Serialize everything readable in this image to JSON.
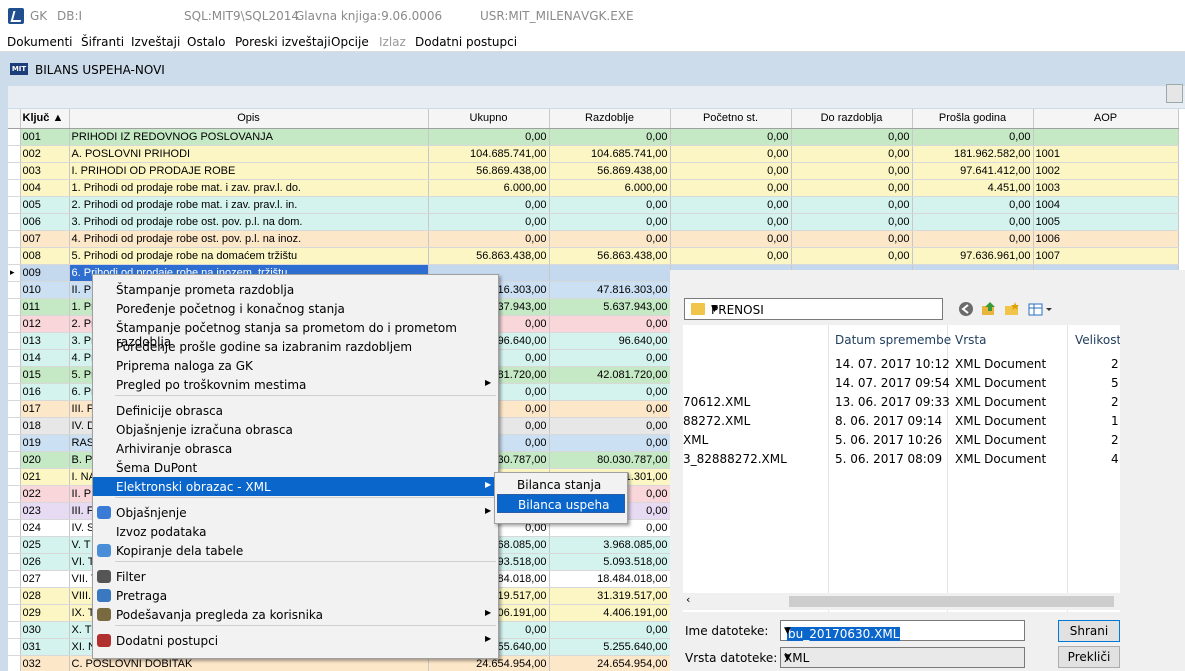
{
  "titlebar": {
    "app": "GK",
    "db": "DB:I",
    "sql": "SQL:MIT9\\SQL2014",
    "ledger": "Glavna knjiga:9.06.0006",
    "user": "USR:MIT_MILENA",
    "exe": "VGK.EXE"
  },
  "menu": [
    "Dokumenti",
    "Šifranti",
    "Izveštaji",
    "Ostalo",
    "Poreski izveštaji",
    "Opcije",
    "Izlaz",
    "Dodatni postupci"
  ],
  "window_title": "BILANS USPEHA-NOVI",
  "grid": {
    "headers": [
      "Ključ",
      "Opis",
      "Ukupno",
      "Razdoblje",
      "Početno st.",
      "Do razdoblja",
      "Prošla godina",
      "AOP"
    ],
    "rows": [
      {
        "k": "001",
        "o": "PRIHODI IZ REDOVNOG POSLOVANJA",
        "u": "0,00",
        "r": "0,00",
        "p": "0,00",
        "d": "0,00",
        "pg": "0,00",
        "a": "",
        "c": "green"
      },
      {
        "k": "002",
        "o": "A. POSLOVNI PRIHODI",
        "u": "104.685.741,00",
        "r": "104.685.741,00",
        "p": "0,00",
        "d": "0,00",
        "pg": "181.962.582,00",
        "a": "1001",
        "c": "yellow"
      },
      {
        "k": "003",
        "o": "I. PRIHODI OD PRODAJE ROBE",
        "u": "56.869.438,00",
        "r": "56.869.438,00",
        "p": "0,00",
        "d": "0,00",
        "pg": "97.641.412,00",
        "a": "1002",
        "c": "yellow"
      },
      {
        "k": "004",
        "o": "1. Prihodi od prodaje robe mat. i zav. prav.l. do.",
        "u": "6.000,00",
        "r": "6.000,00",
        "p": "0,00",
        "d": "0,00",
        "pg": "4.451,00",
        "a": "1003",
        "c": "yellow"
      },
      {
        "k": "005",
        "o": "2. Prihodi od prodaje robe mat. i zav. prav.l. in.",
        "u": "0,00",
        "r": "0,00",
        "p": "0,00",
        "d": "0,00",
        "pg": "0,00",
        "a": "1004",
        "c": "cyan"
      },
      {
        "k": "006",
        "o": "3. Prihodi od prodaje robe ost. pov. p.l. na dom.",
        "u": "0,00",
        "r": "0,00",
        "p": "0,00",
        "d": "0,00",
        "pg": "0,00",
        "a": "1005",
        "c": "cyan"
      },
      {
        "k": "007",
        "o": "4. Prihodi od prodaje robe ost. pov. p.l. na inoz.",
        "u": "0,00",
        "r": "0,00",
        "p": "0,00",
        "d": "0,00",
        "pg": "0,00",
        "a": "1006",
        "c": "peach"
      },
      {
        "k": "008",
        "o": "5. Prihodi od prodaje robe na domaćem tržištu",
        "u": "56.863.438,00",
        "r": "56.863.438,00",
        "p": "0,00",
        "d": "0,00",
        "pg": "97.636.961,00",
        "a": "1007",
        "c": "yellow"
      },
      {
        "k": "009",
        "o": "6. Prihodi od prodaje robe na inozem. tržištu",
        "u": "",
        "r": "",
        "p": "",
        "d": "",
        "pg": "",
        "a": "",
        "c": "sel"
      },
      {
        "k": "010",
        "o": "II. PI",
        "u": "47.816.303,00",
        "r": "47.816.303,00",
        "p": "",
        "d": "",
        "pg": "",
        "a": "",
        "c": "blue"
      },
      {
        "k": "011",
        "o": "1. Pr",
        "u": "5.637.943,00",
        "r": "5.637.943,00",
        "p": "",
        "d": "",
        "pg": "",
        "a": "",
        "c": "green"
      },
      {
        "k": "012",
        "o": "2. Pr",
        "u": "0,00",
        "r": "0,00",
        "p": "",
        "d": "",
        "pg": "",
        "a": "",
        "c": "pink"
      },
      {
        "k": "013",
        "o": "3. Pr",
        "u": "96.640,00",
        "r": "96.640,00",
        "p": "",
        "d": "",
        "pg": "",
        "a": "",
        "c": "cyan"
      },
      {
        "k": "014",
        "o": "4. Pr",
        "u": "0,00",
        "r": "0,00",
        "p": "",
        "d": "",
        "pg": "",
        "a": "",
        "c": "cyan"
      },
      {
        "k": "015",
        "o": "5. Pr",
        "u": "42.081.720,00",
        "r": "42.081.720,00",
        "p": "",
        "d": "",
        "pg": "",
        "a": "",
        "c": "green"
      },
      {
        "k": "016",
        "o": "6. Pr",
        "u": "0,00",
        "r": "0,00",
        "p": "",
        "d": "",
        "pg": "",
        "a": "",
        "c": "cyan"
      },
      {
        "k": "017",
        "o": "III. P",
        "u": "0,00",
        "r": "0,00",
        "p": "",
        "d": "",
        "pg": "",
        "a": "",
        "c": "peach"
      },
      {
        "k": "018",
        "o": "IV. D",
        "u": "0,00",
        "r": "0,00",
        "p": "",
        "d": "",
        "pg": "",
        "a": "",
        "c": "grey"
      },
      {
        "k": "019",
        "o": "RAS",
        "u": "0,00",
        "r": "0,00",
        "p": "",
        "d": "",
        "pg": "",
        "a": "",
        "c": "blue"
      },
      {
        "k": "020",
        "o": "B. P",
        "u": "80.030.787,00",
        "r": "80.030.787,00",
        "p": "",
        "d": "",
        "pg": "",
        "a": "",
        "c": "green"
      },
      {
        "k": "021",
        "o": "I. NA",
        "u": "81.301,00",
        "r": "81.301,00",
        "p": "",
        "d": "",
        "pg": "",
        "a": "",
        "c": "yellow"
      },
      {
        "k": "022",
        "o": "II. PI",
        "u": "0,00",
        "r": "0,00",
        "p": "",
        "d": "",
        "pg": "",
        "a": "",
        "c": "pink"
      },
      {
        "k": "023",
        "o": "III. F",
        "u": "0,00",
        "r": "0,00",
        "p": "",
        "d": "",
        "pg": "",
        "a": "",
        "c": "lav"
      },
      {
        "k": "024",
        "o": "IV. S",
        "u": "0,00",
        "r": "0,00",
        "p": "",
        "d": "",
        "pg": "",
        "a": "",
        "c": "white"
      },
      {
        "k": "025",
        "o": "V. T",
        "u": "3.968.085,00",
        "r": "3.968.085,00",
        "p": "",
        "d": "",
        "pg": "",
        "a": "",
        "c": "cyan"
      },
      {
        "k": "026",
        "o": "VI. T",
        "u": "5.093.518,00",
        "r": "5.093.518,00",
        "p": "",
        "d": "",
        "pg": "",
        "a": "",
        "c": "cyan"
      },
      {
        "k": "027",
        "o": "VII. T",
        "u": "18.484.018,00",
        "r": "18.484.018,00",
        "p": "",
        "d": "",
        "pg": "",
        "a": "",
        "c": "white"
      },
      {
        "k": "028",
        "o": "VIII.",
        "u": "31.319.517,00",
        "r": "31.319.517,00",
        "p": "",
        "d": "",
        "pg": "",
        "a": "",
        "c": "yellow"
      },
      {
        "k": "029",
        "o": "IX. T",
        "u": "4.406.191,00",
        "r": "4.406.191,00",
        "p": "",
        "d": "",
        "pg": "",
        "a": "",
        "c": "yellow"
      },
      {
        "k": "030",
        "o": "X. T",
        "u": "0,00",
        "r": "0,00",
        "p": "",
        "d": "",
        "pg": "",
        "a": "",
        "c": "cyan"
      },
      {
        "k": "031",
        "o": "XI. N",
        "u": "5.255.640,00",
        "r": "5.255.640,00",
        "p": "",
        "d": "",
        "pg": "",
        "a": "",
        "c": "cyan"
      },
      {
        "k": "032",
        "o": "C. POSLOVNI DOBITAK",
        "u": "24.654.954,00",
        "r": "24.654.954,00",
        "p": "",
        "d": "",
        "pg": "",
        "a": "",
        "c": "peach"
      }
    ]
  },
  "context_menu": {
    "items": [
      "Štampanje prometa razdoblja",
      "Poređenje početnog i konačnog stanja",
      "Štampanje početnog stanja sa prometom do i prometom razdoblja",
      "Poređenje prošle godine sa izabranim razdobljem",
      "Priprema naloga za GK",
      "Pregled po troškovnim mestima",
      "Definicije obrasca",
      "Objašnjenje izračuna obrasca",
      "Arhiviranje obrasca",
      "Šema DuPont",
      "Elektronski obrazac - XML",
      "Objašnjenje",
      "Izvoz podataka",
      "Kopiranje dela tabele",
      "Filter",
      "Pretraga",
      "Podešavanja pregleda za korisnika",
      "Dodatni postupci"
    ],
    "submenu": [
      "Bilanca stanja",
      "Bilanca uspeha"
    ]
  },
  "save_dialog": {
    "folder": "PRENOSI",
    "columns": [
      "Datum spremembe",
      "Vrsta",
      "Velikost"
    ],
    "files": [
      {
        "name": "",
        "date": "14. 07. 2017 10:12",
        "type": "XML Document",
        "size": "2"
      },
      {
        "name": "",
        "date": "14. 07. 2017 09:54",
        "type": "XML Document",
        "size": "5"
      },
      {
        "name": "70612.XML",
        "date": "13. 06. 2017 09:33",
        "type": "XML Document",
        "size": "2"
      },
      {
        "name": "88272.XML",
        "date": "8. 06. 2017 09:14",
        "type": "XML Document",
        "size": "1"
      },
      {
        "name": "XML",
        "date": "5. 06. 2017 10:26",
        "type": "XML Document",
        "size": "2"
      },
      {
        "name": "3_82888272.XML",
        "date": "5. 06. 2017 08:09",
        "type": "XML Document",
        "size": "4"
      }
    ],
    "filename_label": "Ime datoteke:",
    "filename_value": "bu_20170630.XML",
    "filetype_label": "Vrsta datoteke:",
    "filetype_value": "XML",
    "save_btn": "Shrani",
    "cancel_btn": "Prekliči"
  }
}
